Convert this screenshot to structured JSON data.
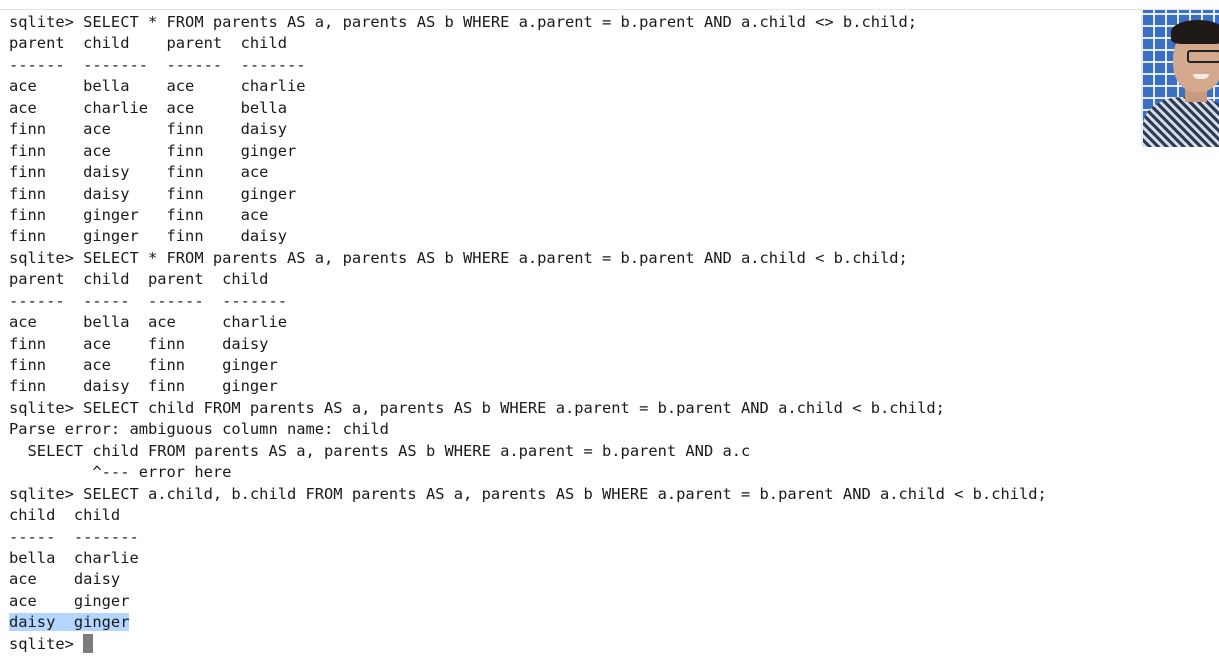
{
  "terminal": {
    "lines": [
      "sqlite> SELECT * FROM parents AS a, parents AS b WHERE a.parent = b.parent AND a.child <> b.child;",
      "parent  child    parent  child",
      "------  -------  ------  -------",
      "ace     bella    ace     charlie",
      "ace     charlie  ace     bella",
      "finn    ace      finn    daisy",
      "finn    ace      finn    ginger",
      "finn    daisy    finn    ace",
      "finn    daisy    finn    ginger",
      "finn    ginger   finn    ace",
      "finn    ginger   finn    daisy",
      "sqlite> SELECT * FROM parents AS a, parents AS b WHERE a.parent = b.parent AND a.child < b.child;",
      "parent  child  parent  child",
      "------  -----  ------  -------",
      "ace     bella  ace     charlie",
      "finn    ace    finn    daisy",
      "finn    ace    finn    ginger",
      "finn    daisy  finn    ginger",
      "sqlite> SELECT child FROM parents AS a, parents AS b WHERE a.parent = b.parent AND a.child < b.child;",
      "Parse error: ambiguous column name: child",
      "  SELECT child FROM parents AS a, parents AS b WHERE a.parent = b.parent AND a.c",
      "         ^--- error here",
      "sqlite> SELECT a.child, b.child FROM parents AS a, parents AS b WHERE a.parent = b.parent AND a.child < b.child;",
      "child  child",
      "-----  -------",
      "bella  charlie",
      "ace    daisy",
      "ace    ginger"
    ],
    "selected_line": "daisy  ginger",
    "prompt": "sqlite> "
  },
  "icons": {
    "cursor": "block-cursor-icon",
    "webcam": "webcam-presenter-icon"
  },
  "colors": {
    "selection": "#b4d5fe",
    "cursor": "#7d7d7d",
    "text": "#1a1a1a"
  }
}
